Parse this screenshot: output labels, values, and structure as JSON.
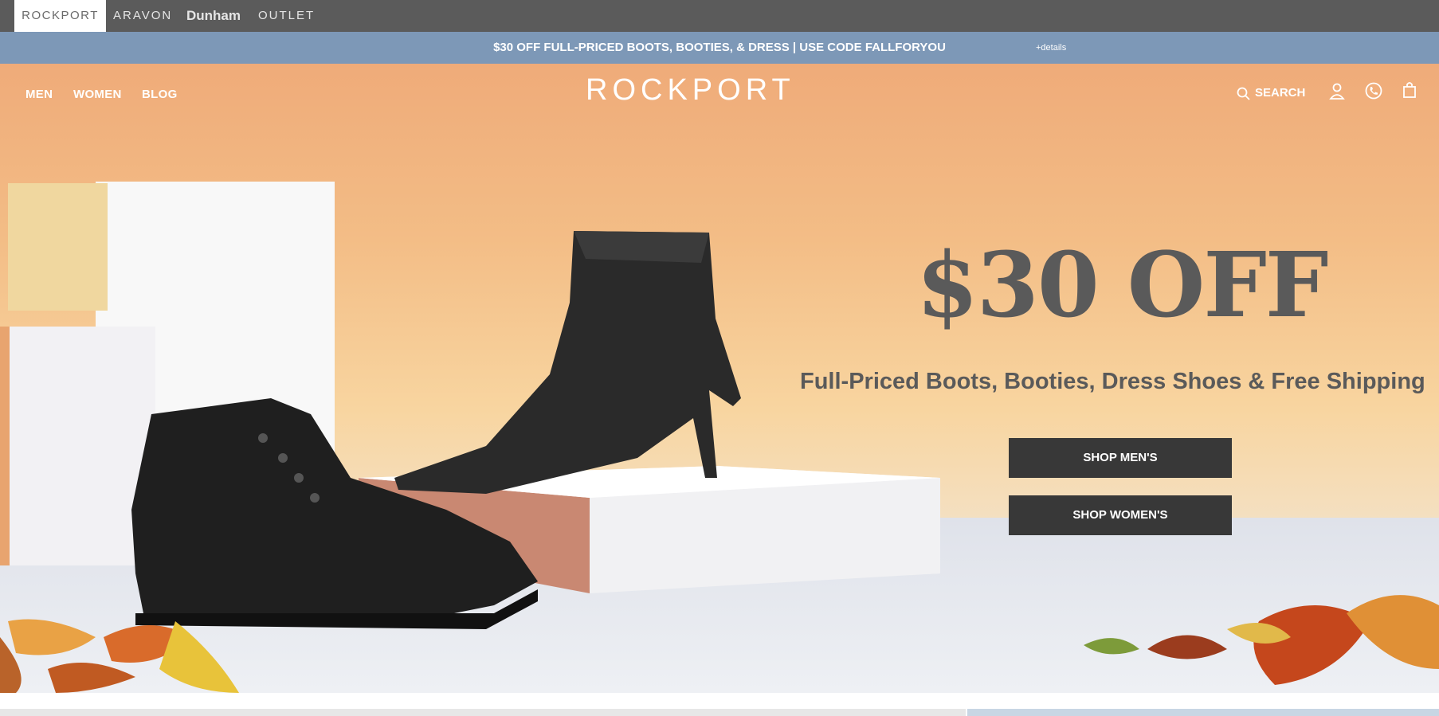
{
  "brands": [
    {
      "label": "ROCKPORT"
    },
    {
      "label": "ARAVON"
    },
    {
      "label": "Dunham"
    },
    {
      "label": "OUTLET"
    }
  ],
  "promo": {
    "text": "$30 OFF FULL-PRICED BOOTS, BOOTIES, & DRESS  |  USE CODE FALLFORYOU",
    "details": "+details"
  },
  "nav": {
    "men": "MEN",
    "women": "WOMEN",
    "blog": "BLOG"
  },
  "logo": "ROCKPORT",
  "header": {
    "search": "SEARCH",
    "icons": [
      "search-icon",
      "account-icon",
      "phone-icon",
      "bag-icon"
    ]
  },
  "hero": {
    "headline": "$30 OFF",
    "subline": "Full-Priced Boots, Booties, Dress Shoes & Free Shipping",
    "cta_men": "SHOP MEN'S",
    "cta_women": "SHOP WOMEN'S"
  },
  "colors": {
    "brandbar": "#5b5b5b",
    "promobar": "#7d98b7",
    "cta": "#383838",
    "text": "#5a5a5a"
  }
}
